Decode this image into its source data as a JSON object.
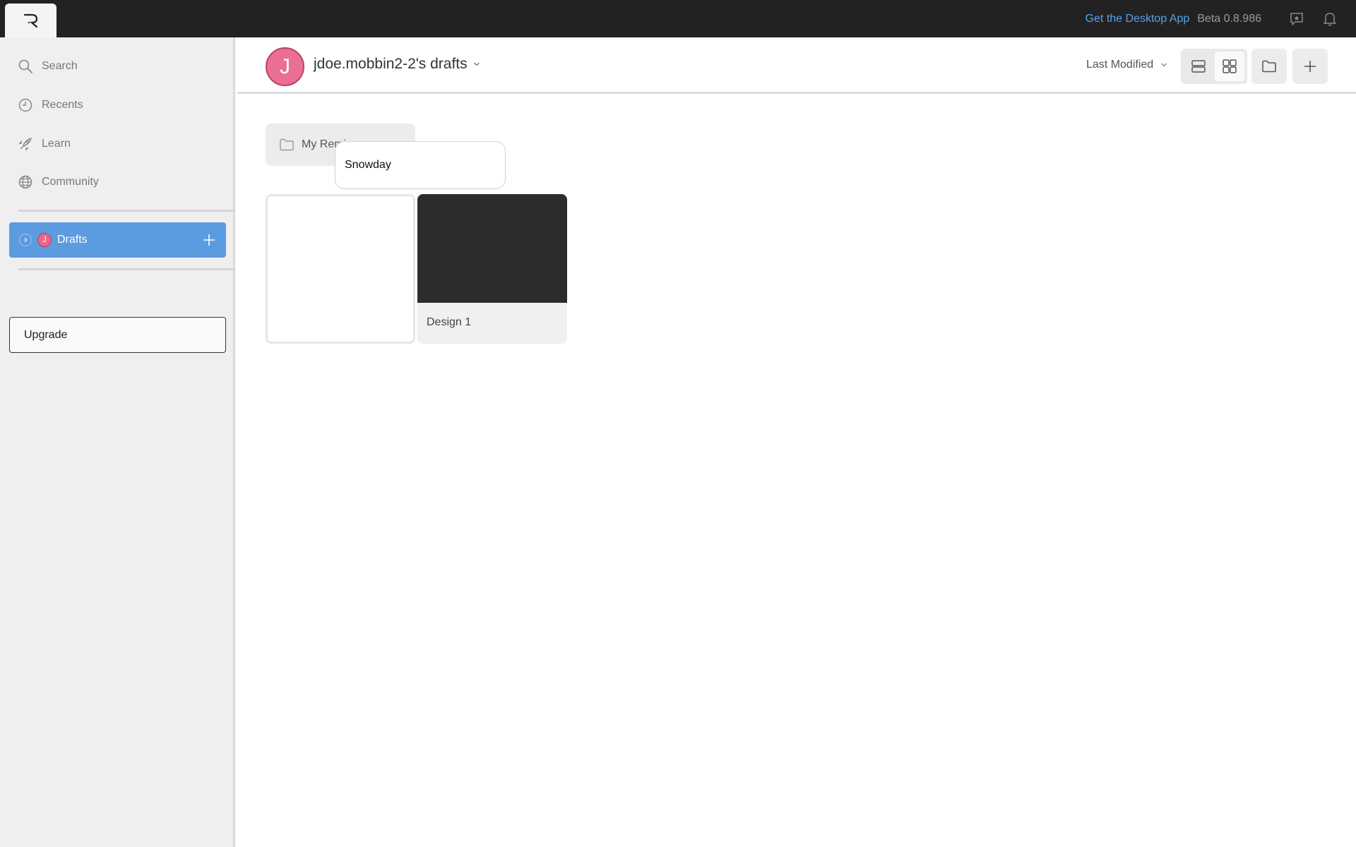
{
  "topbar": {
    "logo": "R",
    "desktop_link": "Get the Desktop App",
    "version": "Beta 0.8.986",
    "icons": [
      "feedback-icon",
      "bell-icon"
    ]
  },
  "sidebar": {
    "items": [
      {
        "label": "Search",
        "icon": "search-icon"
      },
      {
        "label": "Recents",
        "icon": "clock-icon"
      },
      {
        "label": "Learn",
        "icon": "rocket-icon"
      },
      {
        "label": "Community",
        "icon": "globe-icon"
      }
    ],
    "drafts": {
      "label": "Drafts",
      "avatar_letter": "J"
    },
    "upgrade_label": "Upgrade"
  },
  "header": {
    "avatar_letter": "J",
    "title": "jdoe.mobbin2-2's drafts",
    "sort_label": "Last Modified"
  },
  "content": {
    "folder": {
      "name": "My Remi"
    },
    "rename_input_value": "Snowday",
    "files": [
      {
        "name": ""
      },
      {
        "name": "Design 1"
      }
    ]
  },
  "colors": {
    "topbar_bg": "#222222",
    "accent": "#5b9be0",
    "link": "#5aa0e6",
    "avatar": "#ea6f93"
  }
}
